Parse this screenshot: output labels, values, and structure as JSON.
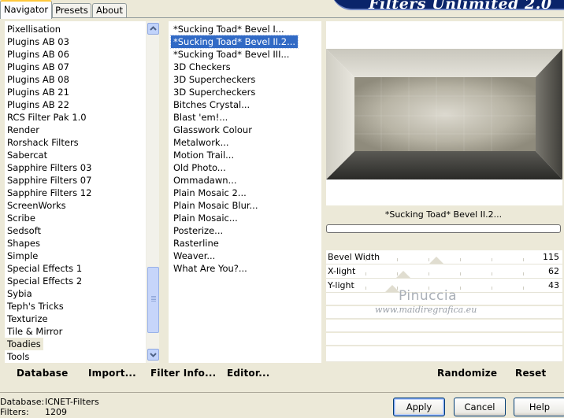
{
  "tabs": [
    {
      "label": "Navigator",
      "active": true
    },
    {
      "label": "Presets",
      "active": false
    },
    {
      "label": "About",
      "active": false
    }
  ],
  "banner_title": "Filters Unlimited 2.0",
  "categories": [
    "Pixellisation",
    "Plugins AB 03",
    "Plugins AB 06",
    "Plugins AB 07",
    "Plugins AB 08",
    "Plugins AB 21",
    "Plugins AB 22",
    "RCS Filter Pak 1.0",
    "Render",
    "Rorshack Filters",
    "Sabercat",
    "Sapphire Filters 03",
    "Sapphire Filters 07",
    "Sapphire Filters 12",
    "ScreenWorks",
    "Scribe",
    "Sedsoft",
    "Shapes",
    "Simple",
    "Special Effects 1",
    "Special Effects 2",
    "Sybia",
    "Teph's Tricks",
    "Texturize",
    "Tile & Mirror",
    "Toadies",
    "Tools"
  ],
  "selected_category": "Toadies",
  "filters": [
    "*Sucking Toad*  Bevel I...",
    "*Sucking Toad*  Bevel II.2...",
    "*Sucking Toad*  Bevel III...",
    "3D Checkers",
    "3D Supercheckers",
    "3D Supercheckers",
    "Bitches Crystal...",
    "Blast 'em!...",
    "Glasswork Colour",
    "Metalwork...",
    "Motion Trail...",
    "Old Photo...",
    "Ommadawn...",
    "Plain Mosaic 2...",
    "Plain Mosaic Blur...",
    "Plain Mosaic...",
    "Posterize...",
    "Rasterline",
    "Weaver...",
    "What Are You?..."
  ],
  "selected_filter": "*Sucking Toad*  Bevel II.2...",
  "preview_caption": "*Sucking Toad*  Bevel II.2...",
  "sliders": [
    {
      "label": "Bevel Width",
      "value": "115",
      "fraction": 0.45
    },
    {
      "label": "X-light",
      "value": "62",
      "fraction": 0.24
    },
    {
      "label": "Y-light",
      "value": "43",
      "fraction": 0.17
    }
  ],
  "watermark": {
    "line1": "Pinuccia",
    "line2": "www.maidiregrafica.eu"
  },
  "toolbar": {
    "database": "Database",
    "import": "Import...",
    "filter_info": "Filter Info...",
    "editor": "Editor...",
    "randomize": "Randomize",
    "reset": "Reset"
  },
  "footer": {
    "database_label": "Database:",
    "database_value": "ICNET-Filters",
    "filters_label": "Filters:",
    "filters_value": "1209"
  },
  "buttons": {
    "apply": "Apply",
    "cancel": "Cancel",
    "help": "Help"
  },
  "colors": {
    "selection": "#316ac5",
    "banner": "#0a246a",
    "window_bg": "#ece9d8"
  }
}
